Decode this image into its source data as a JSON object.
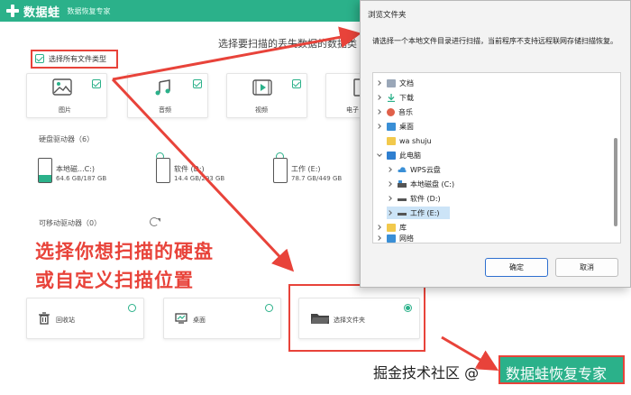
{
  "app": {
    "name": "数据蛙",
    "subtitle": "数据恢复专家",
    "headline": "选择要扫描的丢失数据的数据类",
    "select_all_label": "选择所有文件类型",
    "file_types": [
      {
        "label": "图片",
        "icon": "image-icon"
      },
      {
        "label": "音频",
        "icon": "music-icon"
      },
      {
        "label": "视频",
        "icon": "video-icon"
      },
      {
        "label": "电子",
        "icon": "document-icon"
      }
    ],
    "hard_drives_title": "硬盘驱动器（6）",
    "drives": [
      {
        "name": "本地磁...C:)",
        "size": "64.6 GB/187 GB"
      },
      {
        "name": "软件 (D:)",
        "size": "14.4 GB/293 GB"
      },
      {
        "name": "工作 (E:)",
        "size": "78.7 GB/449 GB"
      }
    ],
    "removable_title": "可移动驱动器（0）",
    "locations": [
      {
        "label": "回收站",
        "icon": "trash-icon",
        "selected": false
      },
      {
        "label": "桌面",
        "icon": "desktop-icon",
        "selected": false
      },
      {
        "label": "选择文件夹",
        "icon": "folder-icon",
        "selected": true
      }
    ],
    "brand_color": "#2bb18a"
  },
  "annotation": {
    "line1": "选择你想扫描的硬盘",
    "line2": "或自定义扫描位置",
    "color": "#e8433a"
  },
  "dialog": {
    "title": "浏览文件夹",
    "description": "请选择一个本地文件目录进行扫描，当前程序不支持远程联网存储扫描恢复。",
    "tree": [
      {
        "label": "文档",
        "icon": "document-folder-icon",
        "expanded": false
      },
      {
        "label": "下载",
        "icon": "download-icon",
        "expanded": false
      },
      {
        "label": "音乐",
        "icon": "music-folder-icon",
        "expanded": false
      },
      {
        "label": "桌面",
        "icon": "desktop-folder-icon",
        "expanded": false
      },
      {
        "label": "wa shuju",
        "icon": "folder-icon",
        "expanded": false
      },
      {
        "label": "此电脑",
        "icon": "computer-icon",
        "expanded": true
      },
      {
        "label": "WPS云盘",
        "icon": "cloud-icon",
        "expanded": false
      },
      {
        "label": "本地磁盘 (C:)",
        "icon": "disk-icon",
        "expanded": false
      },
      {
        "label": "软件 (D:)",
        "icon": "drive-icon",
        "expanded": false
      },
      {
        "label": "工作 (E:)",
        "icon": "drive-icon",
        "expanded": false,
        "selected": true
      },
      {
        "label": "库",
        "icon": "library-icon",
        "expanded": false
      },
      {
        "label": "网络",
        "icon": "network-icon",
        "expanded": false
      }
    ],
    "ok_label": "确定",
    "cancel_label": "取消"
  },
  "watermark": {
    "prefix": "掘金技术社区 @",
    "brand": "数据蛙恢复专家"
  }
}
